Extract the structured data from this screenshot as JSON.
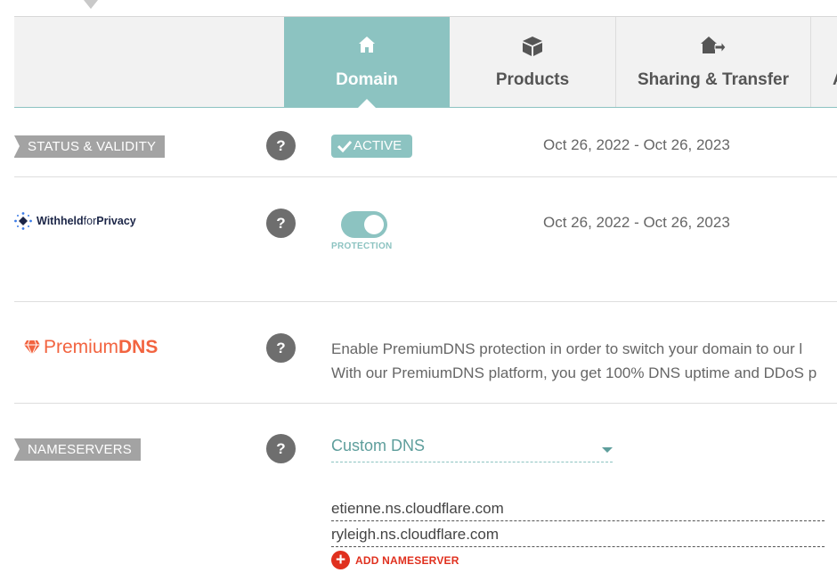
{
  "tabs": [
    {
      "label": "Domain",
      "icon": "home-icon",
      "active": true
    },
    {
      "label": "Products",
      "icon": "box-icon",
      "active": false
    },
    {
      "label": "Sharing & Transfer",
      "icon": "house-arrow-icon",
      "active": false
    },
    {
      "label": "A",
      "icon": "",
      "active": false
    }
  ],
  "status": {
    "label": "STATUS & VALIDITY",
    "help": "?",
    "badge": "ACTIVE",
    "dates": "Oct 26, 2022 - Oct 26, 2023"
  },
  "privacy": {
    "logo_main": "Withheld",
    "logo_for": "for",
    "logo_end": "Privacy",
    "help": "?",
    "toggle_label": "PROTECTION",
    "toggle_on": true,
    "dates": "Oct 26, 2022 - Oct 26, 2023"
  },
  "premiumdns": {
    "logo_premium": "Premium",
    "logo_dns": "DNS",
    "help": "?",
    "line1": "Enable PremiumDNS protection in order to switch your domain to our l",
    "line2": "With our PremiumDNS platform, you get 100% DNS uptime and DDoS p"
  },
  "nameservers": {
    "label": "NAMESERVERS",
    "help": "?",
    "selected": "Custom DNS",
    "entries": [
      "etienne.ns.cloudflare.com",
      "ryleigh.ns.cloudflare.com"
    ],
    "add_plus": "+",
    "add_label": "ADD NAMESERVER"
  },
  "colors": {
    "teal": "#8cc3c1",
    "gray_label": "#a3a3a3",
    "help_gray": "#6e6e6e",
    "add_red": "#e0301e",
    "premiumdns_orange": "#f26440",
    "withheld_navy": "#1b2547"
  }
}
